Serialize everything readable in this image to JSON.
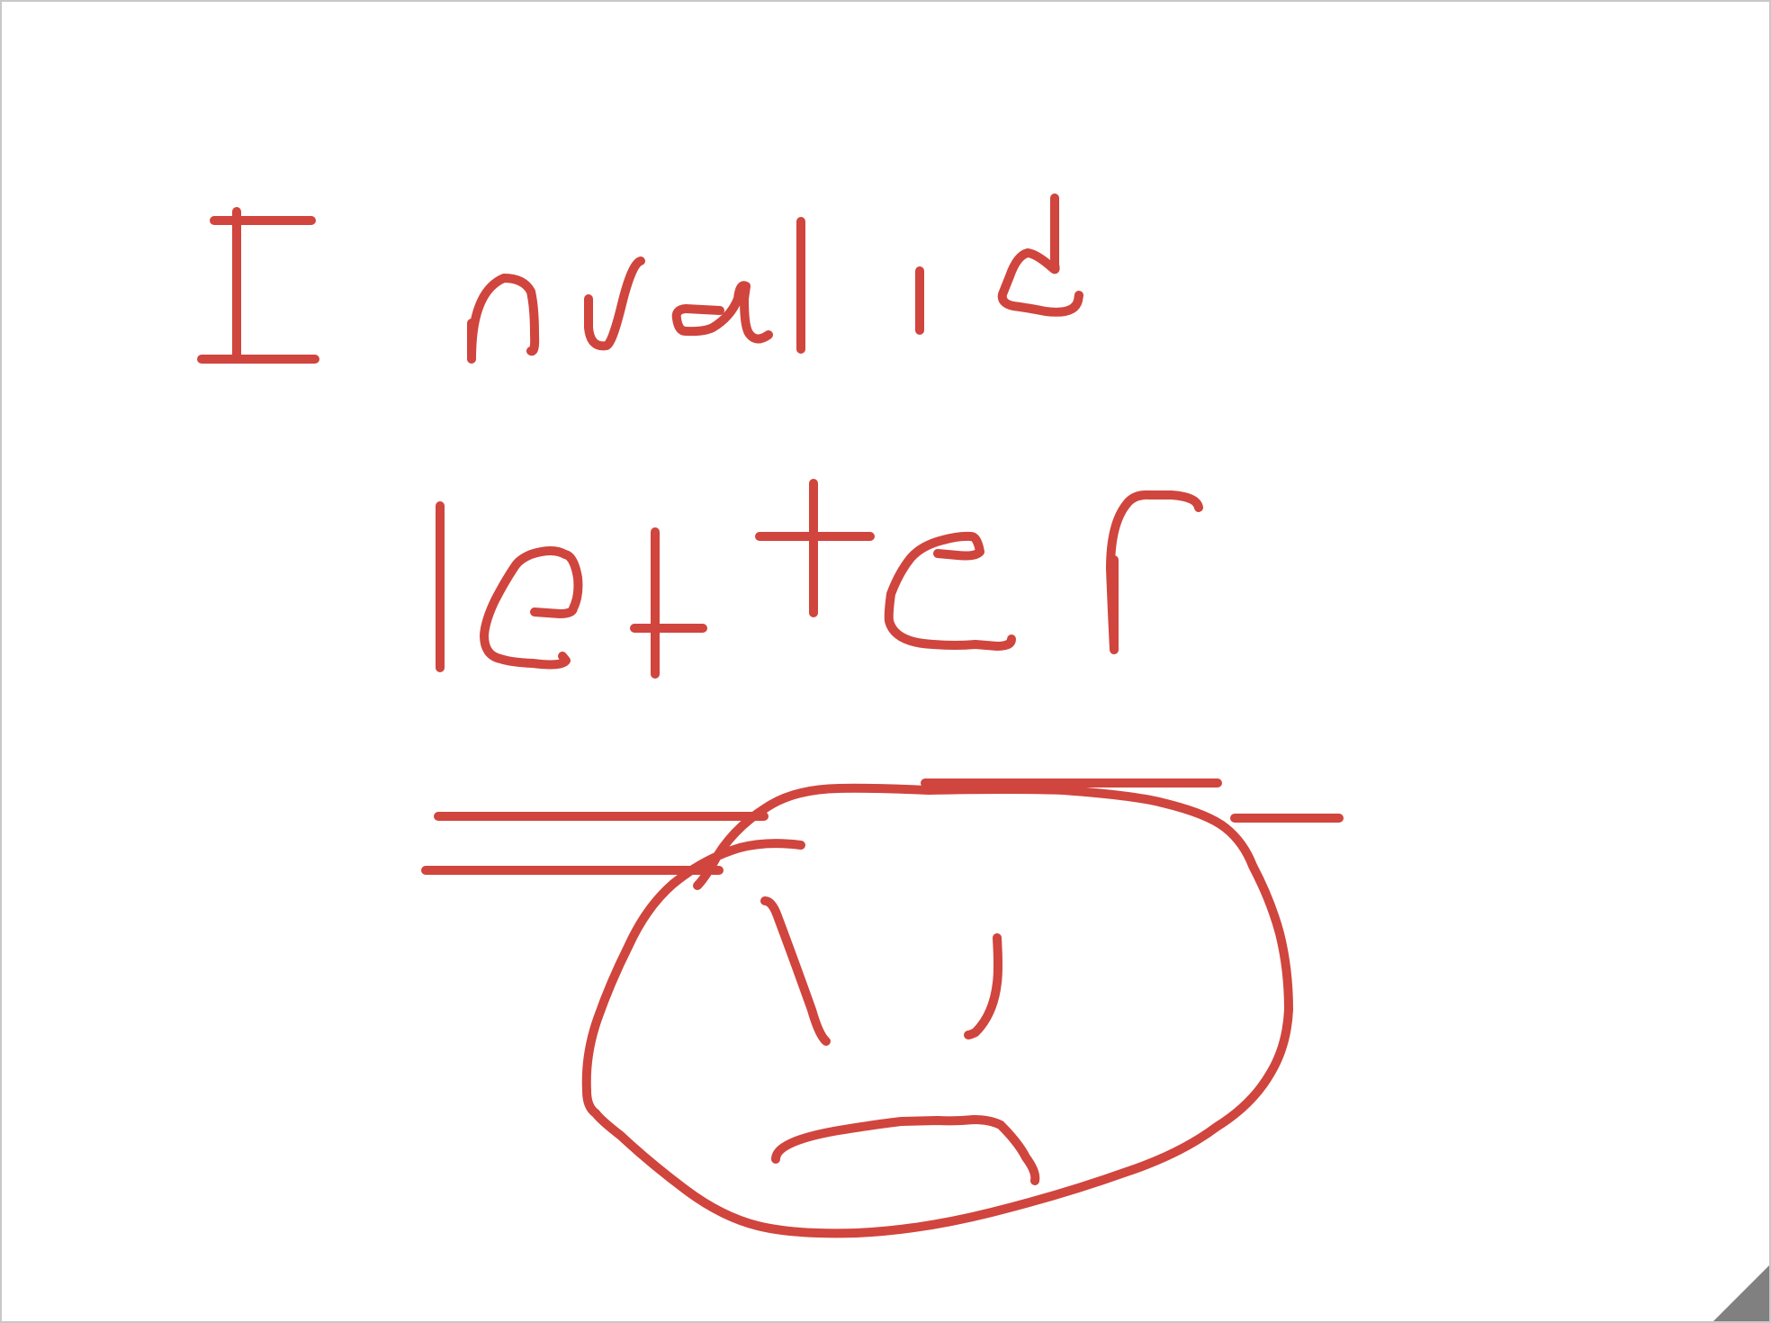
{
  "canvas": {
    "background": "#ffffff",
    "border_color": "#c8c8c8",
    "ink_color": "#d0453d",
    "handle_color": "#808080"
  },
  "drawing": {
    "handwritten_text_line_1": "Invalid",
    "handwritten_text_line_2": "letter",
    "doodle": "sad-face"
  },
  "icons": {
    "resize_handle": "resize-grip-icon"
  }
}
